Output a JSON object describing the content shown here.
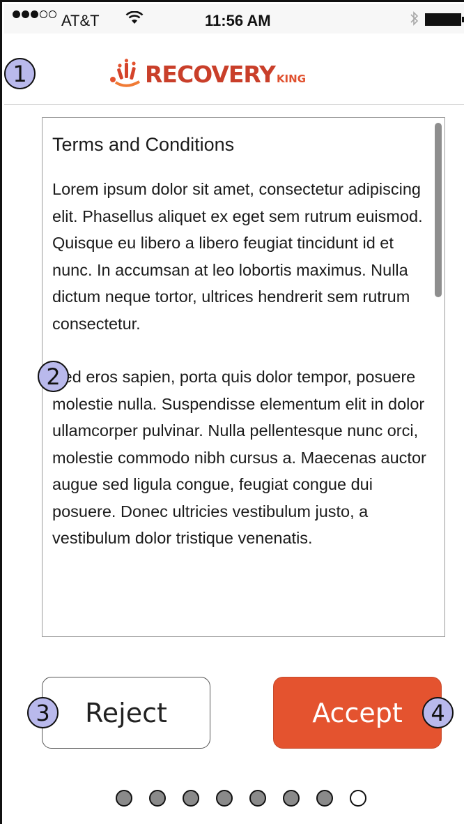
{
  "status_bar": {
    "signal_dots_filled": 3,
    "signal_dots_total": 5,
    "carrier": "AT&T",
    "time": "11:56 AM",
    "bluetooth_icon": "bluetooth-icon",
    "battery_level": 1.0
  },
  "header": {
    "logo_text": "RECOVERY",
    "logo_subtext": "KING",
    "logo_color": "#c93f2a"
  },
  "terms": {
    "title": "Terms and Conditions",
    "paragraphs": [
      "Lorem ipsum dolor sit amet, consectetur adipiscing elit. Phasellus aliquet ex eget sem rutrum euismod. Quisque eu libero a libero feugiat tincidunt id et nunc. In accumsan at leo lobortis maximus. Nulla dictum neque tortor, ultrices hendrerit sem rutrum consectetur.",
      "Sed eros sapien, porta quis dolor tempor, posuere molestie nulla. Suspendisse elementum elit in dolor ullamcorper pulvinar. Nulla pellentesque nunc orci, molestie commodo nibh cursus a. Maecenas auctor augue sed ligula congue, feugiat congue dui posuere. Donec ultricies vestibulum justo, a vestibulum dolor tristique venenatis."
    ]
  },
  "buttons": {
    "reject_label": "Reject",
    "accept_label": "Accept",
    "accept_color": "#e4532f"
  },
  "annotations": {
    "badge_1": "1",
    "badge_2": "2",
    "badge_3": "3",
    "badge_4": "4"
  },
  "pagination": {
    "total_pages": 8,
    "current_page": 8
  }
}
